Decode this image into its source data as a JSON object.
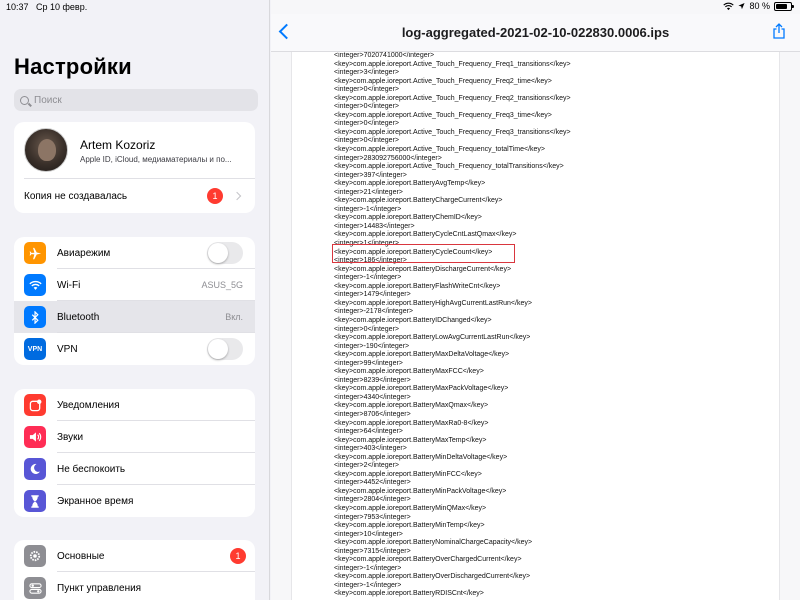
{
  "statusbar": {
    "time": "10:37",
    "date": "Ср 10 февр.",
    "battery": "80 %",
    "battery_level": 0.8
  },
  "sidebar": {
    "title": "Настройки",
    "search_placeholder": "Поиск",
    "profile": {
      "name": "Artem Kozoriz",
      "subtitle": "Apple ID, iCloud, медиаматериалы и по...",
      "backup_label": "Копия не создавалась",
      "backup_badge": "1"
    },
    "connectivity": [
      {
        "label": "Авиарежим",
        "icon": "airplane-icon",
        "color": "#ff9500",
        "toggle": false
      },
      {
        "label": "Wi-Fi",
        "icon": "wifi-icon",
        "color": "#007aff",
        "value": "ASUS_5G"
      },
      {
        "label": "Bluetooth",
        "icon": "bluetooth-icon",
        "color": "#007aff",
        "value": "Вкл.",
        "selected": true
      },
      {
        "label": "VPN",
        "icon": "vpn-icon",
        "color": "#006be0",
        "icon_text": "VPN",
        "toggle": false
      }
    ],
    "notifications": [
      {
        "label": "Уведомления",
        "icon": "notifications-icon",
        "color": "#ff3b30"
      },
      {
        "label": "Звуки",
        "icon": "sounds-icon",
        "color": "#ff2d55"
      },
      {
        "label": "Не беспокоить",
        "icon": "moon-icon",
        "color": "#5856d6"
      },
      {
        "label": "Экранное время",
        "icon": "hourglass-icon",
        "color": "#5856d6"
      }
    ],
    "general": [
      {
        "label": "Основные",
        "icon": "gear-icon",
        "color": "#8e8e93",
        "badge": "1"
      },
      {
        "label": "Пункт управления",
        "icon": "control-center-icon",
        "color": "#8e8e93"
      }
    ]
  },
  "document": {
    "title": "log-aggregated-2021-02-10-022830.0006.ips",
    "highlighted_line_index": 23,
    "lines": [
      "<integer>7020741000</integer>",
      "<key>com.apple.ioreport.Active_Touch_Frequency_Freq1_transitions</key>",
      "<integer>3</integer>",
      "<key>com.apple.ioreport.Active_Touch_Frequency_Freq2_time</key>",
      "<integer>0</integer>",
      "<key>com.apple.ioreport.Active_Touch_Frequency_Freq2_transitions</key>",
      "<integer>0</integer>",
      "<key>com.apple.ioreport.Active_Touch_Frequency_Freq3_time</key>",
      "<integer>0</integer>",
      "<key>com.apple.ioreport.Active_Touch_Frequency_Freq3_transitions</key>",
      "<integer>0</integer>",
      "<key>com.apple.ioreport.Active_Touch_Frequency_totalTime</key>",
      "<integer>283092756000</integer>",
      "<key>com.apple.ioreport.Active_Touch_Frequency_totalTransitions</key>",
      "<integer>397</integer>",
      "<key>com.apple.ioreport.BatteryAvgTemp</key>",
      "<integer>21</integer>",
      "<key>com.apple.ioreport.BatteryChargeCurrent</key>",
      "<integer>-1</integer>",
      "<key>com.apple.ioreport.BatteryChemID</key>",
      "<integer>14483</integer>",
      "<key>com.apple.ioreport.BatteryCycleCntLastQmax</key>",
      "<integer>1</integer>",
      "<key>com.apple.ioreport.BatteryCycleCount</key>",
      "<integer>186</integer>",
      "<key>com.apple.ioreport.BatteryDischargeCurrent</key>",
      "<integer>-1</integer>",
      "<key>com.apple.ioreport.BatteryFlashWriteCnt</key>",
      "<integer>1479</integer>",
      "<key>com.apple.ioreport.BatteryHighAvgCurrentLastRun</key>",
      "<integer>-2178</integer>",
      "<key>com.apple.ioreport.BatteryIDChanged</key>",
      "<integer>0</integer>",
      "<key>com.apple.ioreport.BatteryLowAvgCurrentLastRun</key>",
      "<integer>-190</integer>",
      "<key>com.apple.ioreport.BatteryMaxDeltaVoltage</key>",
      "<integer>99</integer>",
      "<key>com.apple.ioreport.BatteryMaxFCC</key>",
      "<integer>8239</integer>",
      "<key>com.apple.ioreport.BatteryMaxPackVoltage</key>",
      "<integer>4340</integer>",
      "<key>com.apple.ioreport.BatteryMaxQmax</key>",
      "<integer>8706</integer>",
      "<key>com.apple.ioreport.BatteryMaxRa0-8</key>",
      "<integer>64</integer>",
      "<key>com.apple.ioreport.BatteryMaxTemp</key>",
      "<integer>403</integer>",
      "<key>com.apple.ioreport.BatteryMinDeltaVoltage</key>",
      "<integer>2</integer>",
      "<key>com.apple.ioreport.BatteryMinFCC</key>",
      "<integer>4452</integer>",
      "<key>com.apple.ioreport.BatteryMinPackVoltage</key>",
      "<integer>2804</integer>",
      "<key>com.apple.ioreport.BatteryMinQMax</key>",
      "<integer>7953</integer>",
      "<key>com.apple.ioreport.BatteryMinTemp</key>",
      "<integer>10</integer>",
      "<key>com.apple.ioreport.BatteryNominalChargeCapacity</key>",
      "<integer>7315</integer>",
      "<key>com.apple.ioreport.BatteryOverChargedCurrent</key>",
      "<integer>-1</integer>",
      "<key>com.apple.ioreport.BatteryOverDischargedCurrent</key>",
      "<integer>-1</integer>",
      "<key>com.apple.ioreport.BatteryRDISCnt</key>"
    ]
  }
}
